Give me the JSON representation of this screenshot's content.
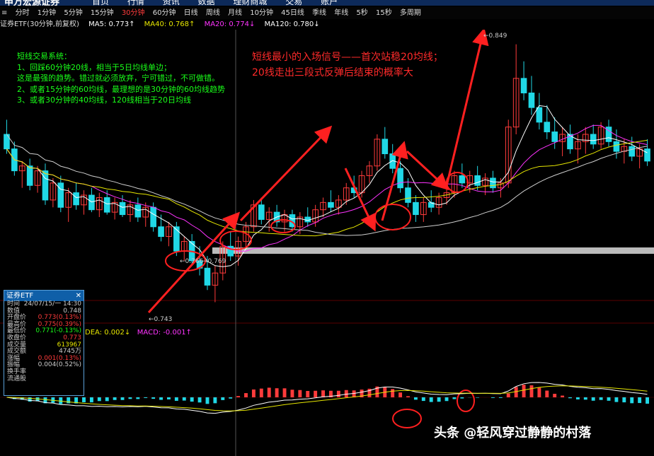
{
  "topbar": {
    "logo": "申万宏源证券",
    "nav": [
      "首页",
      "行情",
      "资讯",
      "数据",
      "理财商城",
      "交易",
      "账户"
    ]
  },
  "periods": {
    "items": [
      "分时",
      "1分钟",
      "5分钟",
      "15分钟",
      "30分钟",
      "60分钟",
      "日线",
      "周线",
      "月线",
      "10分钟",
      "45日线",
      "季线",
      "年线",
      "5秒",
      "15秒",
      "多周期"
    ],
    "active": "30分钟"
  },
  "ma_legend": {
    "title": "证券ETF(30分钟,前复权)",
    "ma5": "MA5: 0.773↑",
    "ma40": "MA40: 0.768↑",
    "ma20": "MA20: 0.774↓",
    "ma120": "MA120: 0.780↓",
    "colors": {
      "ma5": "#ffffff",
      "ma40": "#e6e600",
      "ma20": "#ff33ff",
      "ma120": "#ffffff"
    }
  },
  "annotations": {
    "green_lines": [
      "短线交易系统：",
      "1、回踩60分钟20线，相当于5日均线单边；",
      "这是最强的趋势。错过就必须放弃，宁可错过，不可做错。",
      "2、或者15分钟的60均线，最理想的是30分钟的60均线趋势",
      "3、或者30分钟的40均线，120线相当于20日均线"
    ],
    "red_lines": [
      "短线最小的入场信号——首次站稳20均线；",
      "20线走出三段式反弹后结束的概率大"
    ]
  },
  "price_labels": {
    "high": "0.849",
    "low": "0.743",
    "mid_left": "0.766",
    "mid_right": "0.769"
  },
  "infobox": {
    "title": "证券ETF",
    "rows": [
      {
        "k": "时间",
        "v": "24/07/15/一 14:30",
        "c": "#cccccc"
      },
      {
        "k": "数值",
        "v": "0.748",
        "c": "#cccccc"
      },
      {
        "k": "开盘价",
        "v": "0.773(0.13%)",
        "c": "#ff3b3b"
      },
      {
        "k": "最高价",
        "v": "0.775(0.39%)",
        "c": "#ff3b3b"
      },
      {
        "k": "最低价",
        "v": "0.771(-0.13%)",
        "c": "#19ff19"
      },
      {
        "k": "收盘价",
        "v": "0.773",
        "c": "#ff3b3b"
      },
      {
        "k": "成交量",
        "v": "613967",
        "c": "#e6e600"
      },
      {
        "k": "成交额",
        "v": "4745万",
        "c": "#cccccc"
      },
      {
        "k": "涨幅",
        "v": "0.001(0.13%)",
        "c": "#ff3b3b"
      },
      {
        "k": "振幅",
        "v": "0.004(0.52%)",
        "c": "#cccccc"
      },
      {
        "k": "换手率",
        "v": "",
        "c": "#cccccc"
      },
      {
        "k": "流通股",
        "v": "",
        "c": "#cccccc"
      }
    ]
  },
  "macd_legend": {
    "dea": "DEA: 0.002↓",
    "macd": "MACD: -0.001↑",
    "dea_color": "#e6e600",
    "macd_color": "#ff33ff"
  },
  "watermark": "头条 @轻风穿过静静的村落",
  "colors": {
    "up": "#ff3b3b",
    "down": "#20d8e6",
    "grid": "#3a0000",
    "annotation": "#ff2020"
  },
  "chart_data": {
    "type": "candlestick",
    "price_range": [
      0.735,
      0.855
    ],
    "candles_ohlc": [
      [
        0.812,
        0.818,
        0.804,
        0.806
      ],
      [
        0.806,
        0.809,
        0.795,
        0.797
      ],
      [
        0.797,
        0.801,
        0.79,
        0.799
      ],
      [
        0.799,
        0.802,
        0.789,
        0.791
      ],
      [
        0.791,
        0.799,
        0.788,
        0.797
      ],
      [
        0.797,
        0.8,
        0.783,
        0.785
      ],
      [
        0.785,
        0.794,
        0.782,
        0.792
      ],
      [
        0.792,
        0.795,
        0.78,
        0.782
      ],
      [
        0.782,
        0.79,
        0.776,
        0.788
      ],
      [
        0.788,
        0.792,
        0.781,
        0.783
      ],
      [
        0.783,
        0.789,
        0.779,
        0.787
      ],
      [
        0.787,
        0.79,
        0.78,
        0.781
      ],
      [
        0.781,
        0.788,
        0.778,
        0.786
      ],
      [
        0.786,
        0.789,
        0.779,
        0.78
      ],
      [
        0.78,
        0.786,
        0.777,
        0.784
      ],
      [
        0.784,
        0.787,
        0.778,
        0.779
      ],
      [
        0.779,
        0.785,
        0.776,
        0.783
      ],
      [
        0.783,
        0.786,
        0.776,
        0.778
      ],
      [
        0.778,
        0.784,
        0.774,
        0.782
      ],
      [
        0.782,
        0.784,
        0.772,
        0.774
      ],
      [
        0.774,
        0.779,
        0.768,
        0.77
      ],
      [
        0.77,
        0.776,
        0.766,
        0.774
      ],
      [
        0.774,
        0.776,
        0.762,
        0.764
      ],
      [
        0.764,
        0.77,
        0.76,
        0.768
      ],
      [
        0.768,
        0.771,
        0.758,
        0.76
      ],
      [
        0.76,
        0.766,
        0.754,
        0.757
      ],
      [
        0.757,
        0.762,
        0.748,
        0.75
      ],
      [
        0.75,
        0.758,
        0.743,
        0.755
      ],
      [
        0.755,
        0.768,
        0.752,
        0.766
      ],
      [
        0.766,
        0.772,
        0.76,
        0.762
      ],
      [
        0.762,
        0.77,
        0.758,
        0.768
      ],
      [
        0.768,
        0.776,
        0.765,
        0.774
      ],
      [
        0.774,
        0.785,
        0.772,
        0.783
      ],
      [
        0.783,
        0.786,
        0.775,
        0.777
      ],
      [
        0.777,
        0.782,
        0.772,
        0.78
      ],
      [
        0.78,
        0.783,
        0.774,
        0.776
      ],
      [
        0.776,
        0.781,
        0.772,
        0.779
      ],
      [
        0.779,
        0.781,
        0.772,
        0.774
      ],
      [
        0.774,
        0.78,
        0.771,
        0.778
      ],
      [
        0.778,
        0.782,
        0.774,
        0.776
      ],
      [
        0.776,
        0.783,
        0.774,
        0.781
      ],
      [
        0.781,
        0.786,
        0.778,
        0.784
      ],
      [
        0.784,
        0.789,
        0.78,
        0.782
      ],
      [
        0.782,
        0.787,
        0.779,
        0.785
      ],
      [
        0.785,
        0.792,
        0.783,
        0.79
      ],
      [
        0.79,
        0.795,
        0.786,
        0.788
      ],
      [
        0.788,
        0.797,
        0.786,
        0.795
      ],
      [
        0.795,
        0.801,
        0.792,
        0.799
      ],
      [
        0.799,
        0.812,
        0.797,
        0.81
      ],
      [
        0.81,
        0.815,
        0.802,
        0.804
      ],
      [
        0.804,
        0.808,
        0.796,
        0.798
      ],
      [
        0.798,
        0.801,
        0.788,
        0.79
      ],
      [
        0.79,
        0.794,
        0.782,
        0.784
      ],
      [
        0.784,
        0.787,
        0.776,
        0.779
      ],
      [
        0.779,
        0.786,
        0.776,
        0.784
      ],
      [
        0.784,
        0.789,
        0.78,
        0.782
      ],
      [
        0.782,
        0.788,
        0.779,
        0.786
      ],
      [
        0.786,
        0.791,
        0.783,
        0.788
      ],
      [
        0.788,
        0.797,
        0.786,
        0.795
      ],
      [
        0.795,
        0.8,
        0.79,
        0.792
      ],
      [
        0.792,
        0.797,
        0.788,
        0.795
      ],
      [
        0.795,
        0.799,
        0.789,
        0.791
      ],
      [
        0.791,
        0.796,
        0.787,
        0.794
      ],
      [
        0.794,
        0.797,
        0.788,
        0.79
      ],
      [
        0.79,
        0.794,
        0.786,
        0.792
      ],
      [
        0.792,
        0.818,
        0.79,
        0.815
      ],
      [
        0.815,
        0.849,
        0.812,
        0.835
      ],
      [
        0.835,
        0.842,
        0.826,
        0.829
      ],
      [
        0.829,
        0.836,
        0.82,
        0.823
      ],
      [
        0.823,
        0.829,
        0.814,
        0.817
      ],
      [
        0.817,
        0.824,
        0.81,
        0.813
      ],
      [
        0.813,
        0.819,
        0.806,
        0.809
      ],
      [
        0.809,
        0.815,
        0.803,
        0.812
      ],
      [
        0.812,
        0.816,
        0.804,
        0.806
      ],
      [
        0.806,
        0.812,
        0.8,
        0.809
      ],
      [
        0.809,
        0.815,
        0.804,
        0.812
      ],
      [
        0.812,
        0.816,
        0.806,
        0.808
      ],
      [
        0.808,
        0.817,
        0.806,
        0.815
      ],
      [
        0.815,
        0.818,
        0.807,
        0.809
      ],
      [
        0.809,
        0.814,
        0.802,
        0.805
      ],
      [
        0.805,
        0.81,
        0.8,
        0.807
      ],
      [
        0.807,
        0.811,
        0.801,
        0.803
      ],
      [
        0.803,
        0.808,
        0.798,
        0.806
      ],
      [
        0.806,
        0.81,
        0.799,
        0.801
      ]
    ],
    "ma_series": [
      "MA5",
      "MA20",
      "MA40",
      "MA120"
    ],
    "macd_range": [
      -0.012,
      0.016
    ],
    "series": [
      {
        "name": "DEA",
        "values": []
      },
      {
        "name": "MACD",
        "values": []
      }
    ]
  }
}
